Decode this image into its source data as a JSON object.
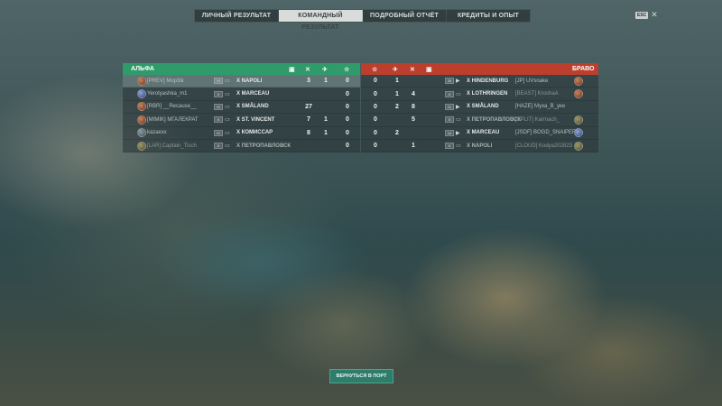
{
  "tabs": [
    {
      "label": "ЛИЧНЫЙ РЕЗУЛЬТАТ",
      "active": false
    },
    {
      "label": "КОМАНДНЫЙ РЕЗУЛЬТАТ",
      "active": true
    },
    {
      "label": "ПОДРОБНЫЙ ОТЧЁТ",
      "active": false
    },
    {
      "label": "КРЕДИТЫ И ОПЫТ",
      "active": false
    }
  ],
  "esc": {
    "key": "ESC",
    "close": "✕"
  },
  "team_left": {
    "name": "АЛЬФА",
    "rows": [
      {
        "badge": "orange",
        "player": "[PREV] Mop3ik",
        "tier": "VI",
        "ship": "X NAPOLI",
        "c1": "3",
        "c2": "1",
        "c3": "0",
        "highlight": true,
        "dim": false
      },
      {
        "badge": "blue",
        "player": "Yerotyashka_m1",
        "tier": "X",
        "ship": "X MARCEAU",
        "c1": "",
        "c2": "",
        "c3": "0",
        "highlight": false,
        "dim": false
      },
      {
        "badge": "orange",
        "player": "[RBR] __Recause__",
        "tier": "IX",
        "ship": "X SMÅLAND",
        "c1": "27",
        "c2": "",
        "c3": "0",
        "highlight": false,
        "dim": false
      },
      {
        "badge": "orange",
        "player": "[MIMIK] МГАЛЕКРАТ",
        "tier": "X",
        "ship": "X ST. VINCENT",
        "c1": "7",
        "c2": "1",
        "c3": "0",
        "highlight": false,
        "dim": false
      },
      {
        "badge": "gray",
        "player": "kazaxxx",
        "tier": "IX",
        "ship": "X КОМИССАР",
        "c1": "8",
        "c2": "1",
        "c3": "0",
        "highlight": false,
        "dim": false
      },
      {
        "badge": "olive",
        "player": "[LAR] Captain_Tisch",
        "tier": "X",
        "ship": "X ПЕТРОПАВЛОВСК",
        "c1": "",
        "c2": "",
        "c3": "0",
        "highlight": false,
        "dim": true
      }
    ]
  },
  "team_right": {
    "name": "БРАВО",
    "rows": [
      {
        "badge": "orange",
        "player": "[JP] UVsnake",
        "tier": "25",
        "ship": "X HINDENBURG",
        "c1": "0",
        "c2": "1",
        "c3": "",
        "dim": false
      },
      {
        "badge": "orange",
        "player": "[BEAST] KroshaA",
        "tier": "X",
        "ship": "X LOTHRINGEN",
        "c1": "0",
        "c2": "1",
        "c3": "4",
        "dim": true
      },
      {
        "badge": "orange",
        "player": "[HAZE] Муха_В_уке",
        "tier": "IX",
        "ship": "X SMÅLAND",
        "c1": "0",
        "c2": "2",
        "c3": "8",
        "dim": false
      },
      {
        "badge": "olive",
        "player": "[SPLIT] Karmach_",
        "tier": "X",
        "ship": "X ПЕТРОПАВЛОВСК",
        "c1": "0",
        "c2": "",
        "c3": "5",
        "dim": true
      },
      {
        "badge": "blue",
        "player": "[JSDF] BOGD_SNAIPER",
        "tier": "10",
        "ship": "X MARCEAU",
        "c1": "0",
        "c2": "2",
        "c3": "",
        "dim": false
      },
      {
        "badge": "olive",
        "player": "[CLOUD] Kodya202823",
        "tier": "X",
        "ship": "X NAPOLI",
        "c1": "0",
        "c2": "",
        "c3": "1",
        "dim": true
      }
    ]
  },
  "icons_left": [
    "ribbon-icon",
    "torpedo-hit-icon",
    "plane-icon",
    "star-icon"
  ],
  "icons_right": [
    "star-icon",
    "plane-icon",
    "torpedo-hit-icon",
    "ribbon-icon"
  ],
  "back_button": "ВЕРНУТЬСЯ В ПОРТ",
  "colors": {
    "team_left": "#2f9b6a",
    "team_right": "#bb3f2c",
    "button": "#2e7c6a"
  }
}
